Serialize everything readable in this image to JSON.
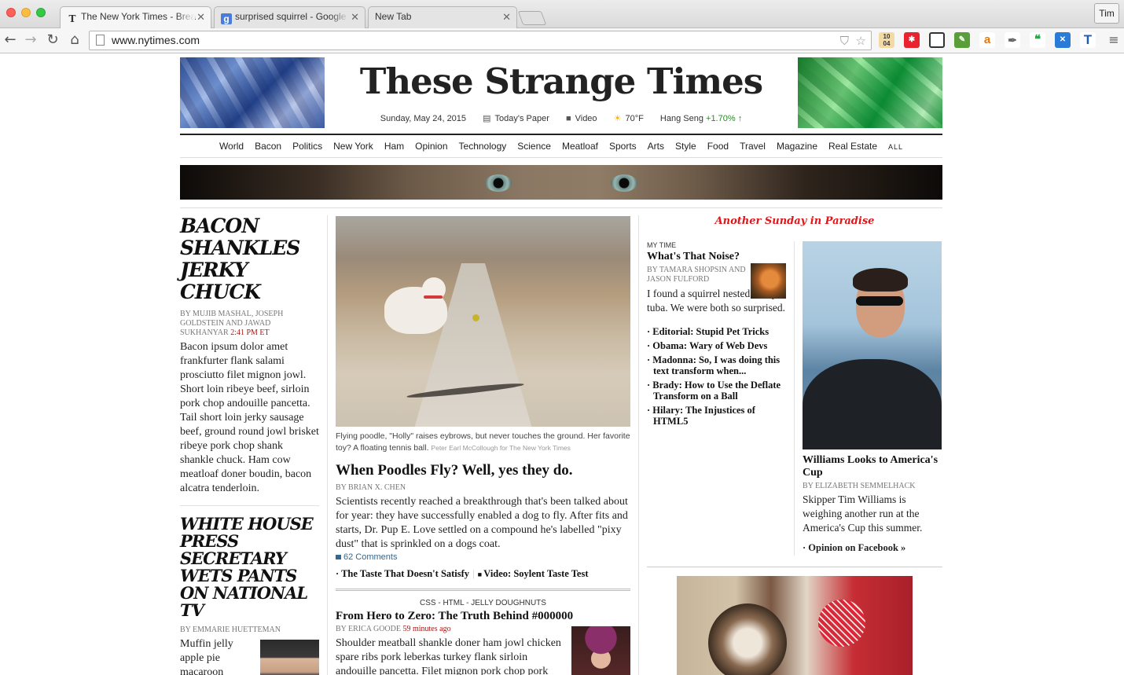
{
  "browser": {
    "tabs": [
      {
        "label": "The New York Times - Brea",
        "icon": "T",
        "active": true
      },
      {
        "label": "surprised squirrel - Google",
        "icon": "g",
        "active": false
      },
      {
        "label": "New Tab",
        "icon": "",
        "active": false
      }
    ],
    "profile": "Tim",
    "url": "www.nytimes.com",
    "extensions": {
      "calendar": "10\n04"
    }
  },
  "masthead": {
    "title": "These Strange Times",
    "date": "Sunday, May 24, 2015",
    "todays_paper": "Today's Paper",
    "video": "Video",
    "weather": "70°F",
    "market_name": "Hang Seng",
    "market_change": "+1.70%"
  },
  "sections": [
    "World",
    "Bacon",
    "Politics",
    "New York",
    "Ham",
    "Opinion",
    "Technology",
    "Science",
    "Meatloaf",
    "Sports",
    "Arts",
    "Style",
    "Food",
    "Travel",
    "Magazine",
    "Real Estate"
  ],
  "sections_all": "ALL",
  "left": {
    "story1": {
      "headline": "BACON SHANKLES JERKY CHUCK",
      "byline": "By MUJIB MASHAL, JOSEPH GOLDSTEIN and JAWAD SUKHANYAR",
      "time": "2:41 PM ET",
      "body": "Bacon ipsum dolor amet frankfurter flank salami prosciutto filet mignon jowl. Short loin ribeye beef, sirloin pork chop andouille pancetta. Tail short loin jerky sausage beef, ground round jowl brisket ribeye pork chop shank shankle chuck. Ham cow meatloaf doner boudin, bacon alcatra tenderloin."
    },
    "story2": {
      "headline": "WHITE HOUSE PRESS SECRETARY WETS PANTS ON NATIONAL TV",
      "byline": "By EMMARIE HUETTEMAN",
      "body": "Muffin jelly apple pie macaroon fruitcake chocolate bar"
    }
  },
  "middle": {
    "caption": "Flying poodle, \"Holly\" raises eybrows, but never touches the ground. Her favorite toy? A floating tennis ball.",
    "credit": "Peter Earl McCollough for The New York Times",
    "headline": "When Poodles Fly? Well, yes they do.",
    "byline": "By BRIAN X. CHEN",
    "body": "Scientists recently reached a breakthrough that's been talked about for year: they have successfully enabled a dog to fly. After fits and starts, Dr. Pup E. Love settled on a compound he's labelled \"pixy dust\" that is sprinkled on a dogs coat.",
    "comments": "62 Comments",
    "related1": "· The Taste That Doesn't Satisfy",
    "related2": "Video: Soylent Taste Test",
    "kicker": "CSS - HTML - JELLY DOUGHNUTS",
    "story2_headline": "From Hero to Zero: The Truth Behind #000000",
    "story2_byline": "By ERICA GOODE",
    "story2_time": "59 minutes ago",
    "story2_body": "Shoulder meatball shankle doner ham jowl chicken spare ribs pork leberkas turkey flank sirloin andouille pancetta. Filet mignon pork chop pork"
  },
  "right": {
    "header": "Another Sunday in Paradise",
    "mytime": {
      "label": "MY TIME",
      "headline": "What's That Noise?",
      "byline": "By TAMARA SHOPSIN and JASON FULFORD",
      "body": "I found a squirrel nested in my tuba. We were both so surprised."
    },
    "links": [
      "· Editorial: Stupid Pet Tricks",
      "· Obama: Wary of Web Devs",
      "· Madonna: So, I was doing this text transform when...",
      "· Brady: How to Use the Deflate Transform on a Ball",
      "· Hilary: The Injustices of HTML5"
    ],
    "sail": {
      "headline": "Williams Looks to America's Cup",
      "byline": "By ELIZABETH SEMMELHACK",
      "body": "Skipper Tim Williams is weighing another run at the America's Cup this summer.",
      "opinion": "· Opinion on Facebook »"
    }
  }
}
